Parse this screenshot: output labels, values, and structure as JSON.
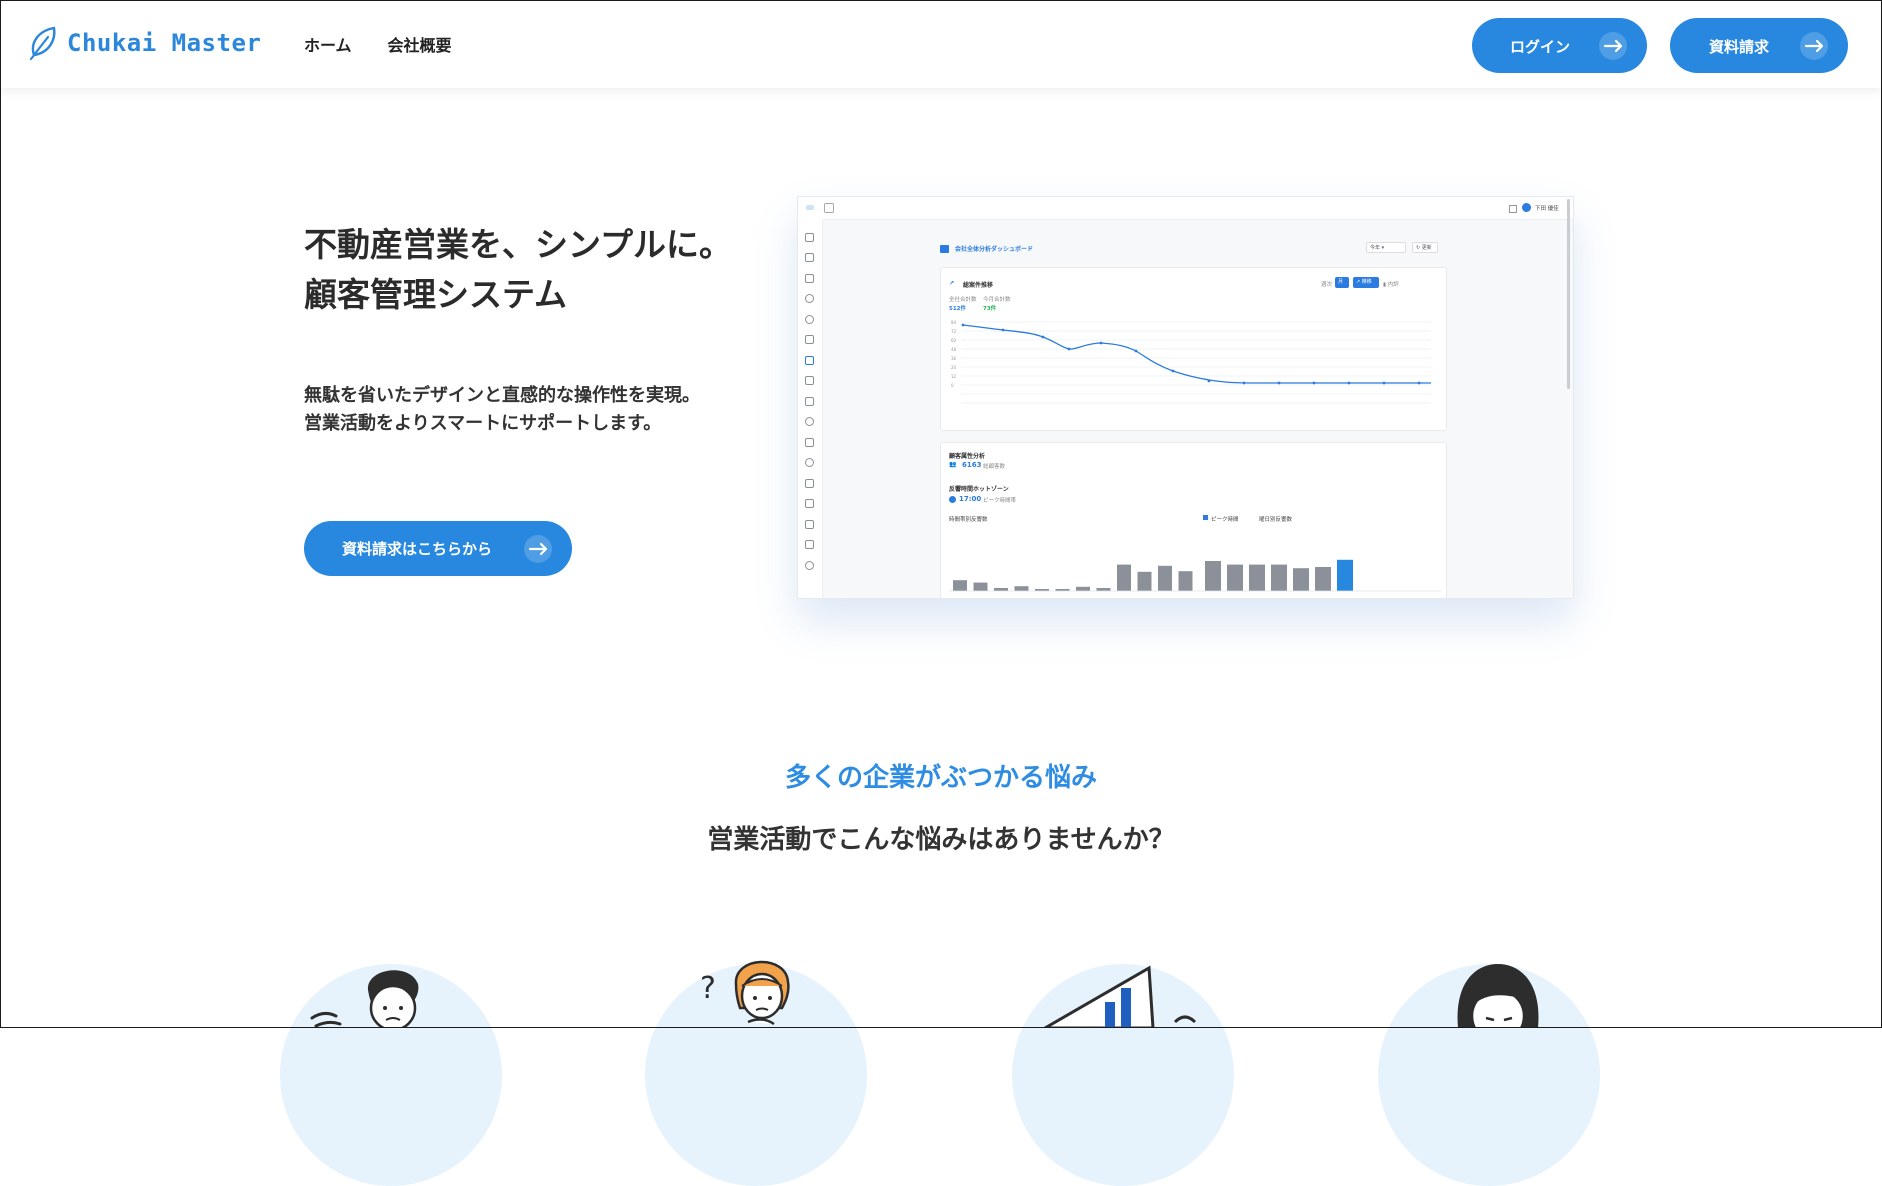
{
  "header": {
    "brand": "Chukai Master",
    "nav": [
      {
        "label": "ホーム"
      },
      {
        "label": "会社概要"
      }
    ],
    "login_label": "ログイン",
    "request_label": "資料請求"
  },
  "hero": {
    "title_line1": "不動産営業を、シンプルに。",
    "title_line2": "顧客管理システム",
    "sub_line1": "無駄を省いたデザインと直感的な操作性を実現。",
    "sub_line2": "営業活動をよりスマートにサポートします。",
    "cta_label": "資料請求はこちらから"
  },
  "dashboard": {
    "top_user": "下田 優佳",
    "title": "会社全体分析ダッシュボード",
    "filter_select": "今年",
    "filter_button": "更新",
    "chart1_title": "総案件推移",
    "stat1_label": "全社合計数",
    "stat1_value": "512件",
    "stat2_label": "今月合計数",
    "stat2_value": "73件",
    "chart_toggles": [
      "週次",
      "月次",
      "推移",
      "内訳"
    ],
    "section2_title": "顧客属性分析",
    "customers_value": "6163",
    "customers_label": "総顧客数",
    "hotzone_title": "反響時間ホットゾーン",
    "hotzone_value": "17:00",
    "hotzone_label": "ピーク時間帯",
    "bar1_title": "時間帯別反響数",
    "bar2_title": "曜日別反響数",
    "legend_peak": "ピーク時間",
    "colors": {
      "accent": "#2888e0",
      "bar_gray": "#8b9099",
      "line": "#2b7be0"
    }
  },
  "problems": {
    "eyebrow": "多くの企業がぶつかる悩み",
    "title": "営業活動でこんな悩みはありませんか？"
  }
}
